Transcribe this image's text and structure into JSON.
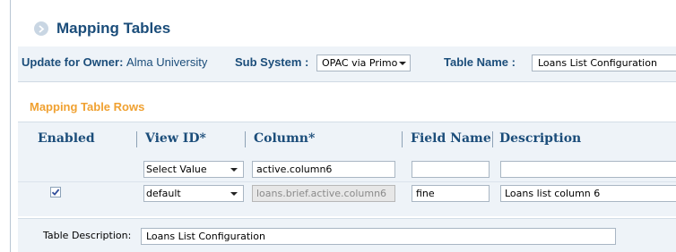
{
  "page": {
    "title": "Mapping Tables"
  },
  "owner_bar": {
    "update_label": "Update for Owner:",
    "owner_value": "Alma University",
    "subsystem_label": "Sub System :",
    "subsystem_value": "OPAC via Primo",
    "table_name_label": "Table Name :",
    "table_name_value": "Loans List Configuration"
  },
  "section": {
    "title": "Mapping Table Rows"
  },
  "grid": {
    "headers": {
      "enabled": "Enabled",
      "view_id": "View ID*",
      "column": "Column*",
      "field_name": "Field Name",
      "description": "Description"
    },
    "new_row": {
      "view_id": "Select Value",
      "column": "active.column6",
      "field_name": "",
      "description": ""
    },
    "rows": [
      {
        "enabled": true,
        "view_id": "default",
        "column": "loans.brief.active.column6",
        "field_name": "fine",
        "description": "Loans list column 6"
      }
    ]
  },
  "table_description": {
    "label": "Table Description:",
    "value": "Loans List Configuration"
  },
  "colors": {
    "title_blue": "#1b4d7a",
    "section_orange": "#f0a131",
    "panel_bg": "#eef3f8"
  },
  "icons": {
    "header_bullet": "chevron-right-icon",
    "dropdown": "caret-down-icon",
    "checkbox": "checkmark-icon"
  }
}
